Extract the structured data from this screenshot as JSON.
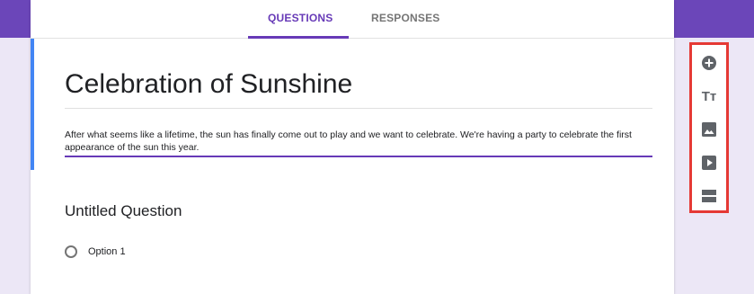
{
  "tabs": {
    "questions": "QUESTIONS",
    "responses": "RESPONSES"
  },
  "form": {
    "title": "Celebration of Sunshine",
    "description": "After what seems like a lifetime, the sun has finally come out to play and we want to celebrate. We're having a party to celebrate the first appearance of the sun this year."
  },
  "question": {
    "title": "Untitled Question",
    "options": [
      "Option 1"
    ]
  },
  "toolbar": {
    "tools": [
      {
        "name": "add-question",
        "icon": "add-circle-icon"
      },
      {
        "name": "add-title-description",
        "icon": "text-icon",
        "glyph": "Tт"
      },
      {
        "name": "add-image",
        "icon": "image-icon"
      },
      {
        "name": "add-video",
        "icon": "video-icon"
      },
      {
        "name": "add-section",
        "icon": "section-icon"
      }
    ]
  },
  "colors": {
    "accent": "#673ab7",
    "header_band": "#6b46b9",
    "background": "#ece7f6",
    "active_bar": "#4285f4",
    "highlight_border": "#e53935",
    "icon": "#5f6368"
  }
}
